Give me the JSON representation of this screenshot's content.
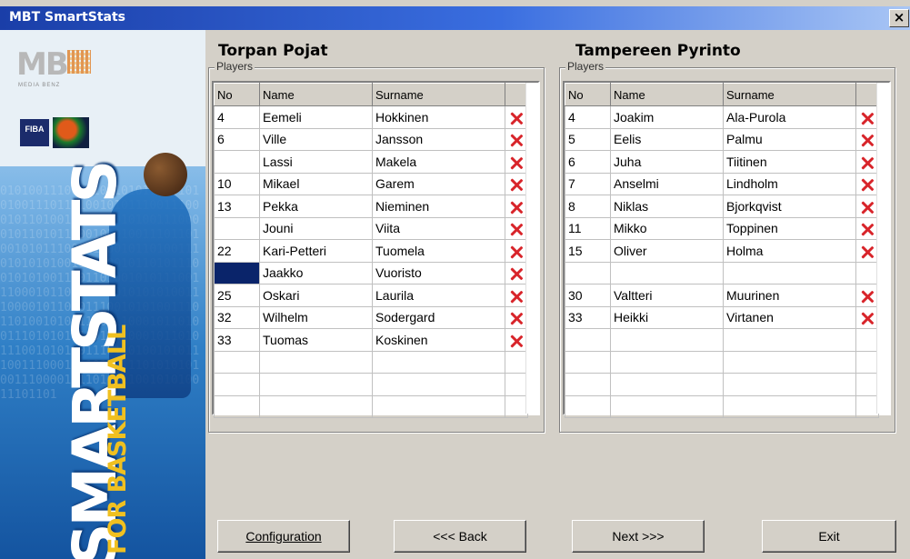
{
  "window": {
    "title": "MBT SmartStats",
    "close_label": "×"
  },
  "sidebar": {
    "brand_text": "SMARTSTATS",
    "brand_sub": "FOR BASKETBALL",
    "logo_text": "MB",
    "logo_sub": "MEDIA BENZ",
    "fiba_text": "FIBA",
    "binary_text": "0101001110000101101011100101010011101101001010111001110001011010011101010101001110000101101011100101010011101101001010111001110001011010011101010101001110000101101011100101010011101101001010111001110001011010011101010101001110000101101011100101010011101101001010111001110001011010011101010101001110000101101011100101010011101101001010111001110001011010011101010101001110000101101011100101010011101101"
  },
  "home": {
    "team_name": "Torpan Pojat",
    "group_label": "Players",
    "columns": [
      "No",
      "Name",
      "Surname",
      ""
    ],
    "rows": [
      {
        "no": "4",
        "name": "Eemeli",
        "surname": "Hokkinen",
        "delete": true
      },
      {
        "no": "6",
        "name": "Ville",
        "surname": "Jansson",
        "delete": true
      },
      {
        "no": "",
        "name": "Lassi",
        "surname": "Makela",
        "delete": true
      },
      {
        "no": "10",
        "name": "Mikael",
        "surname": "Garem",
        "delete": true
      },
      {
        "no": "13",
        "name": "Pekka",
        "surname": "Nieminen",
        "delete": true
      },
      {
        "no": "",
        "name": "Jouni",
        "surname": "Viita",
        "delete": true
      },
      {
        "no": "22",
        "name": "Kari-Petteri",
        "surname": "Tuomela",
        "delete": true
      },
      {
        "no": "",
        "name": "Jaakko",
        "surname": "Vuoristo",
        "delete": true,
        "selected": true
      },
      {
        "no": "25",
        "name": "Oskari",
        "surname": "Laurila",
        "delete": true
      },
      {
        "no": "32",
        "name": "Wilhelm",
        "surname": "Sodergard",
        "delete": true
      },
      {
        "no": "33",
        "name": "Tuomas",
        "surname": "Koskinen",
        "delete": true
      },
      {
        "no": "",
        "name": "",
        "surname": "",
        "delete": false
      },
      {
        "no": "",
        "name": "",
        "surname": "",
        "delete": false
      },
      {
        "no": "",
        "name": "",
        "surname": "",
        "delete": false
      }
    ]
  },
  "away": {
    "team_name": "Tampereen Pyrinto",
    "group_label": "Players",
    "columns": [
      "No",
      "Name",
      "Surname",
      ""
    ],
    "rows": [
      {
        "no": "4",
        "name": "Joakim",
        "surname": "Ala-Purola",
        "delete": true
      },
      {
        "no": "5",
        "name": "Eelis",
        "surname": "Palmu",
        "delete": true
      },
      {
        "no": "6",
        "name": "Juha",
        "surname": "Tiitinen",
        "delete": true
      },
      {
        "no": "7",
        "name": "Anselmi",
        "surname": "Lindholm",
        "delete": true
      },
      {
        "no": "8",
        "name": "Niklas",
        "surname": "Bjorkqvist",
        "delete": true
      },
      {
        "no": "11",
        "name": "Mikko",
        "surname": "Toppinen",
        "delete": true
      },
      {
        "no": "15",
        "name": "Oliver",
        "surname": "Holma",
        "delete": true
      },
      {
        "no": "",
        "name": "",
        "surname": "",
        "delete": false
      },
      {
        "no": "30",
        "name": "Valtteri",
        "surname": "Muurinen",
        "delete": true
      },
      {
        "no": "33",
        "name": "Heikki",
        "surname": "Virtanen",
        "delete": true
      },
      {
        "no": "",
        "name": "",
        "surname": "",
        "delete": false
      },
      {
        "no": "",
        "name": "",
        "surname": "",
        "delete": false
      },
      {
        "no": "",
        "name": "",
        "surname": "",
        "delete": false
      },
      {
        "no": "",
        "name": "",
        "surname": "",
        "delete": false
      }
    ]
  },
  "buttons": {
    "configuration": "Configuration",
    "back": "<<< Back",
    "next": "Next >>>",
    "exit": "Exit"
  },
  "colors": {
    "delete_icon": "#d8242a",
    "selection": "#0a246a",
    "titlebar": "#1a3ea8"
  }
}
